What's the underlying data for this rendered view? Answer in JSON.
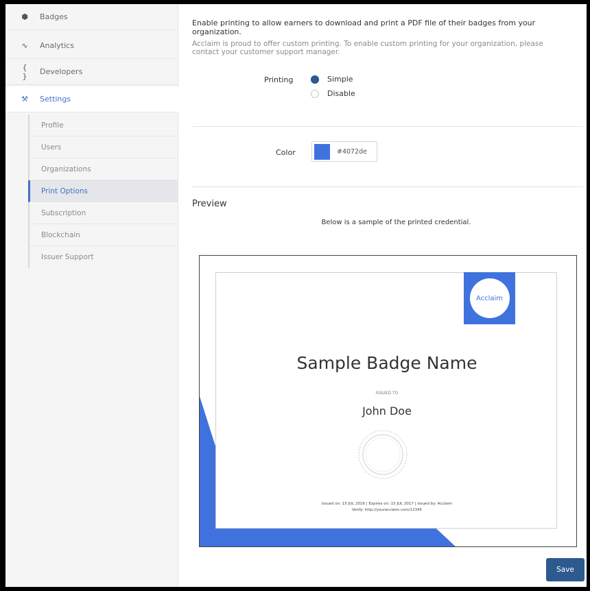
{
  "sidebar": {
    "items": [
      {
        "label": "Badges",
        "icon": "badge-icon"
      },
      {
        "label": "Analytics",
        "icon": "analytics-icon"
      },
      {
        "label": "Developers",
        "icon": "code-braces-icon"
      },
      {
        "label": "Settings",
        "icon": "tools-icon"
      }
    ],
    "settings_subitems": [
      "Profile",
      "Users",
      "Organizations",
      "Print Options",
      "Subscription",
      "Blockchain",
      "Issuer Support"
    ],
    "active_item": "Settings",
    "active_subitem": "Print Options"
  },
  "main": {
    "intro": "Enable printing to allow earners to download and print a PDF file of their badges from your organization.",
    "custom_note": "Acclaim is proud to offer custom printing. To enable custom printing for your organization, please contact your customer support manager.",
    "printing": {
      "label": "Printing",
      "options": [
        "Simple",
        "Disable"
      ],
      "selected": "Simple"
    },
    "color": {
      "label": "Color",
      "value": "#4072de"
    },
    "preview": {
      "title": "Preview",
      "subtitle": "Below is a sample of the printed credential."
    },
    "certificate": {
      "logo_text": "Acclaim",
      "badge_name": "Sample Badge Name",
      "issued_to_label": "ISSUED TO",
      "earner_name": "John Doe",
      "footer_line1": "Issued on: 15 JUL 2016 | Expires on: 15 JUL 2017 | Issued by: Acclaim",
      "footer_line2": "Verify: http://youracclaim.com/12345"
    },
    "save_label": "Save"
  },
  "colors": {
    "accent": "#4072de",
    "button": "#2d5a8e",
    "active_link": "#3f72c9"
  }
}
